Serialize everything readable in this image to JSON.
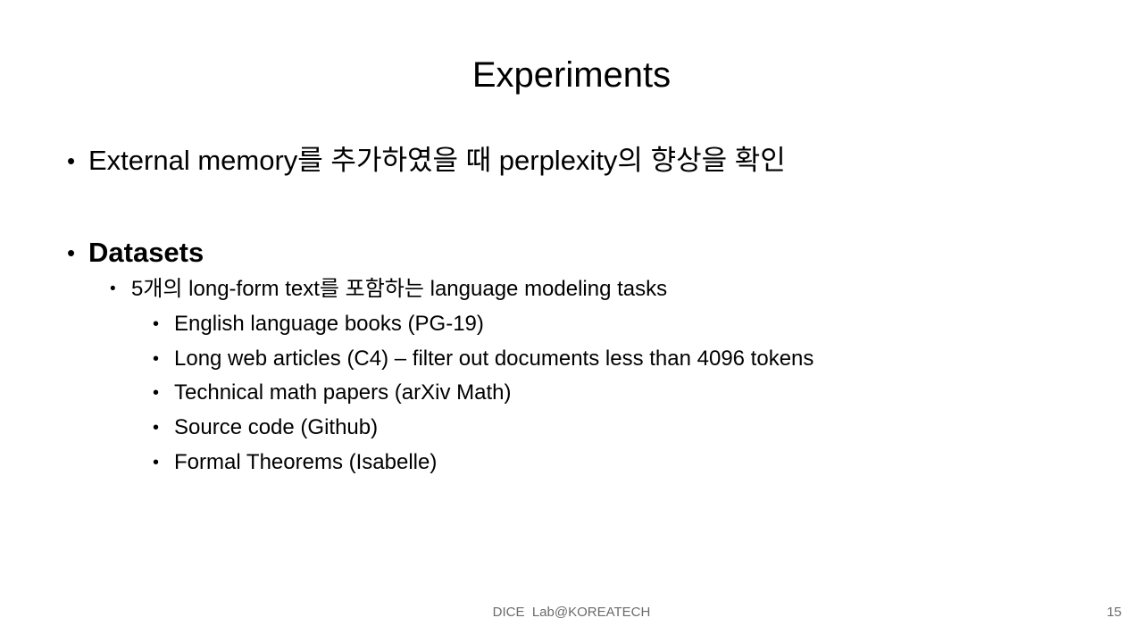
{
  "slide": {
    "title": "Experiments",
    "bullet_char": "•",
    "point1": "External memory를 추가하였을 때 perplexity의 향상을 확인",
    "datasets_heading": "Datasets",
    "datasets_sub": "5개의 long-form text를 포함하는 language modeling tasks",
    "dataset_items": [
      "English language books (PG-19)",
      "Long web articles (C4) – filter out documents less than 4096 tokens",
      "Technical math papers (arXiv Math)",
      "Source code (Github)",
      "Formal Theorems (Isabelle)"
    ]
  },
  "footer": {
    "text": "DICE  Lab@KOREATECH",
    "page_number": "15"
  }
}
